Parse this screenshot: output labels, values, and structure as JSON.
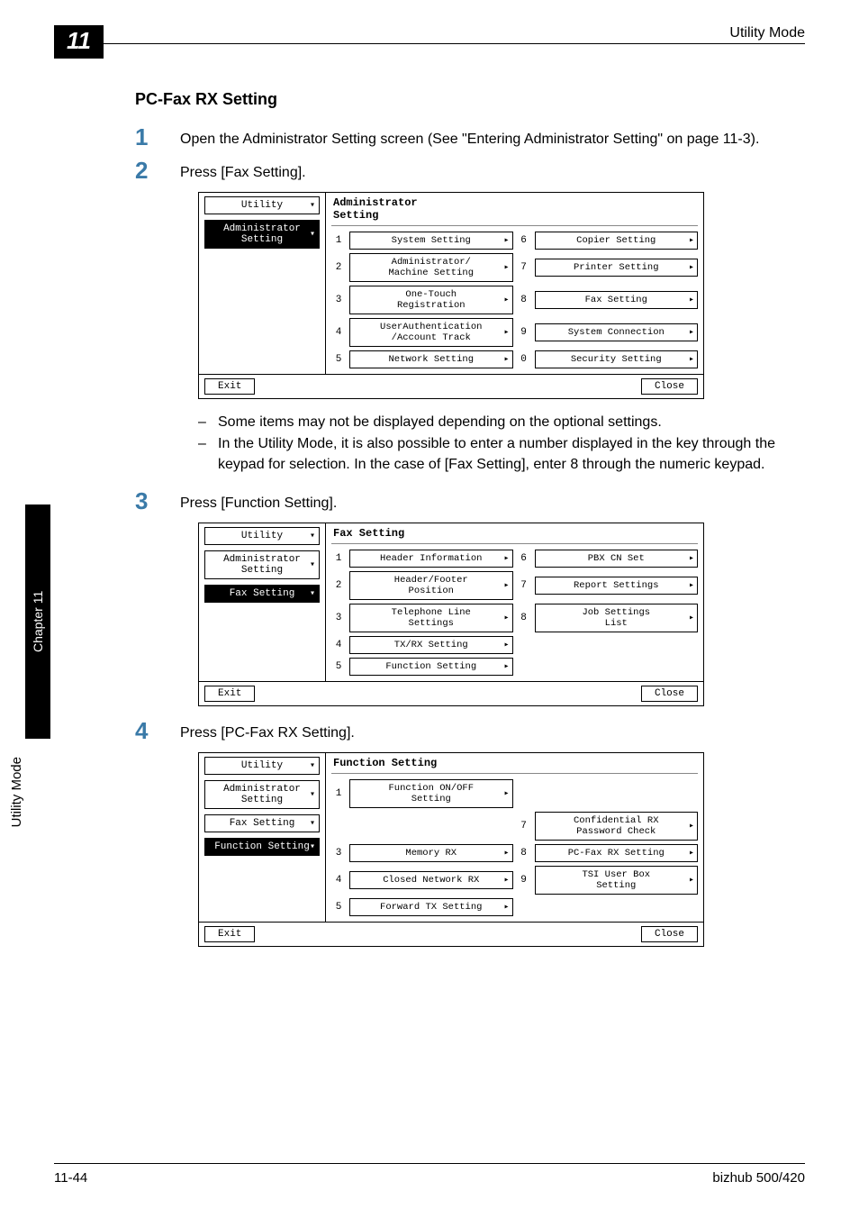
{
  "header": {
    "chapter_number": "11",
    "right": "Utility Mode"
  },
  "section_title": "PC-Fax RX Setting",
  "steps": {
    "s1": {
      "num": "1",
      "text": "Open the Administrator Setting screen (See \"Entering Administrator Setting\" on page 11-3)."
    },
    "s2": {
      "num": "2",
      "text": "Press [Fax Setting]."
    },
    "s3": {
      "num": "3",
      "text": "Press [Function Setting]."
    },
    "s4": {
      "num": "4",
      "text": "Press [PC-Fax RX Setting]."
    }
  },
  "notes": {
    "n1": "Some items may not be displayed depending on the optional settings.",
    "n2": "In the Utility Mode, it is also possible to enter a number displayed in the key through the keypad for selection. In the case of [Fax Setting], enter 8 through the numeric keypad."
  },
  "screen1": {
    "title": "Administrator\nSetting",
    "crumbs": [
      {
        "label": "Utility",
        "selected": false
      },
      {
        "label": "Administrator\nSetting",
        "selected": true
      }
    ],
    "buttons": [
      {
        "n": "1",
        "label": "System Setting"
      },
      {
        "n": "6",
        "label": "Copier Setting"
      },
      {
        "n": "2",
        "label": "Administrator/\nMachine Setting"
      },
      {
        "n": "7",
        "label": "Printer Setting"
      },
      {
        "n": "3",
        "label": "One-Touch\nRegistration"
      },
      {
        "n": "8",
        "label": "Fax Setting"
      },
      {
        "n": "4",
        "label": "UserAuthentication\n/Account Track"
      },
      {
        "n": "9",
        "label": "System Connection"
      },
      {
        "n": "5",
        "label": "Network Setting"
      },
      {
        "n": "0",
        "label": "Security Setting"
      }
    ],
    "exit": "Exit",
    "close": "Close"
  },
  "screen2": {
    "title": "Fax Setting",
    "crumbs": [
      {
        "label": "Utility",
        "selected": false
      },
      {
        "label": "Administrator\nSetting",
        "selected": false
      },
      {
        "label": "Fax Setting",
        "selected": true
      }
    ],
    "buttons": [
      {
        "n": "1",
        "label": "Header Information"
      },
      {
        "n": "6",
        "label": "PBX CN Set"
      },
      {
        "n": "2",
        "label": "Header/Footer\nPosition"
      },
      {
        "n": "7",
        "label": "Report Settings"
      },
      {
        "n": "3",
        "label": "Telephone Line\nSettings"
      },
      {
        "n": "8",
        "label": "Job Settings\nList"
      },
      {
        "n": "4",
        "label": "TX/RX Setting"
      },
      {
        "n": "",
        "label": ""
      },
      {
        "n": "5",
        "label": "Function Setting"
      },
      {
        "n": "",
        "label": ""
      }
    ],
    "exit": "Exit",
    "close": "Close"
  },
  "screen3": {
    "title": "Function Setting",
    "crumbs": [
      {
        "label": "Utility",
        "selected": false
      },
      {
        "label": "Administrator\nSetting",
        "selected": false
      },
      {
        "label": "Fax Setting",
        "selected": false
      },
      {
        "label": "Function Setting",
        "selected": true
      }
    ],
    "buttons": [
      {
        "n": "1",
        "label": "Function ON/OFF\nSetting"
      },
      {
        "n": "",
        "label": ""
      },
      {
        "n": "",
        "label": ""
      },
      {
        "n": "7",
        "label": "Confidential RX\nPassword Check"
      },
      {
        "n": "3",
        "label": "Memory RX"
      },
      {
        "n": "8",
        "label": "PC-Fax RX Setting"
      },
      {
        "n": "4",
        "label": "Closed Network RX"
      },
      {
        "n": "9",
        "label": "TSI User Box\nSetting"
      },
      {
        "n": "5",
        "label": "Forward TX Setting"
      },
      {
        "n": "",
        "label": ""
      }
    ],
    "exit": "Exit",
    "close": "Close"
  },
  "sidetab": {
    "chapter": "Chapter 11",
    "label": "Utility Mode"
  },
  "footer": {
    "left": "11-44",
    "right": "bizhub 500/420"
  }
}
